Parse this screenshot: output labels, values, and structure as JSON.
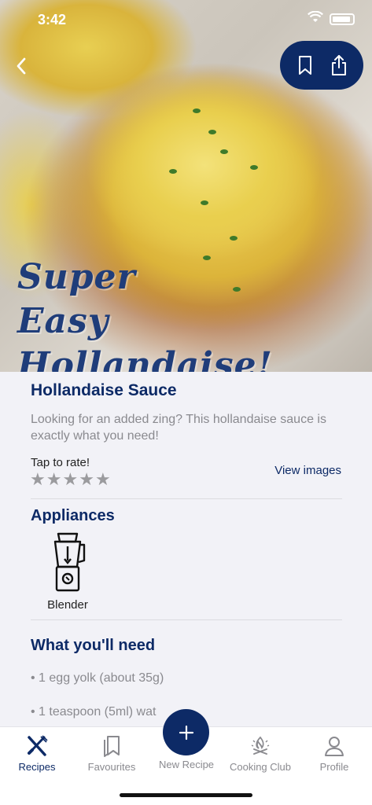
{
  "status_bar": {
    "time": "3:42"
  },
  "hero": {
    "title_line1": "Super Easy",
    "title_line2": "Hollandaise!",
    "icons": {
      "back": "chevron-left-icon",
      "bookmark": "bookmark-icon",
      "share": "share-icon"
    }
  },
  "recipe": {
    "title": "Hollandaise Sauce",
    "description": "Looking for an added zing? This hollandaise sauce is exactly what you need!",
    "rate_label": "Tap to rate!",
    "rating": {
      "value": 0,
      "max": 5
    },
    "view_images": "View images"
  },
  "appliances": {
    "heading": "Appliances",
    "items": [
      {
        "label": "Blender",
        "icon": "blender-icon"
      }
    ]
  },
  "ingredients": {
    "heading": "What you'll need",
    "items": [
      "• 1 egg yolk (about 35g)",
      "• 1 teaspoon (5ml) wat"
    ]
  },
  "tabbar": {
    "tabs": [
      {
        "label": "Recipes",
        "icon": "utensils-icon",
        "active": true
      },
      {
        "label": "Favourites",
        "icon": "bookmarks-icon",
        "active": false
      },
      {
        "label": "New Recipe",
        "icon": "plus-icon",
        "active": false
      },
      {
        "label": "Cooking Club",
        "icon": "campfire-icon",
        "active": false
      },
      {
        "label": "Profile",
        "icon": "person-icon",
        "active": false
      }
    ]
  },
  "colors": {
    "brand": "#0d2a66",
    "muted": "#8a8a8f",
    "background": "#f2f2f7"
  }
}
